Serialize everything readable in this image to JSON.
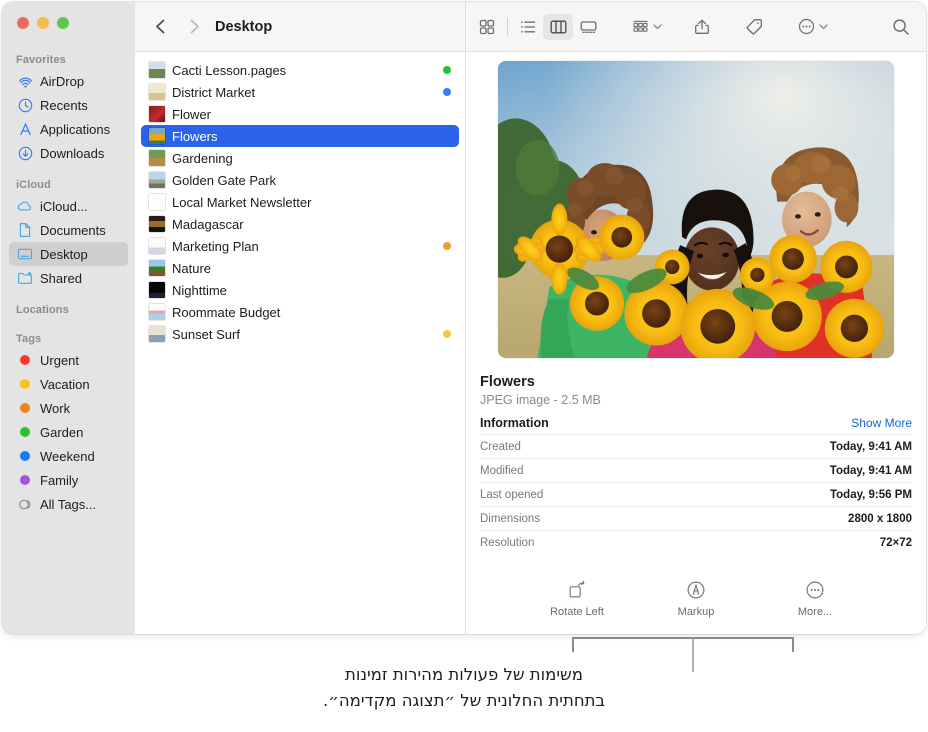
{
  "window": {
    "traffic_lights": [
      "close",
      "minimize",
      "zoom"
    ],
    "breadcrumb": "Desktop",
    "back_label": "Back",
    "forward_label": "Forward"
  },
  "sidebar": {
    "sections": [
      {
        "header": "Favorites",
        "items": [
          {
            "label": "AirDrop",
            "icon": "airdrop-icon",
            "selected": false
          },
          {
            "label": "Recents",
            "icon": "clock-icon",
            "selected": false
          },
          {
            "label": "Applications",
            "icon": "applications-icon",
            "selected": false
          },
          {
            "label": "Downloads",
            "icon": "downloads-icon",
            "selected": false
          }
        ]
      },
      {
        "header": "iCloud",
        "items": [
          {
            "label": "iCloud...",
            "icon": "cloud-icon",
            "selected": false
          },
          {
            "label": "Documents",
            "icon": "document-icon",
            "selected": false
          },
          {
            "label": "Desktop",
            "icon": "desktop-icon",
            "selected": true
          },
          {
            "label": "Shared",
            "icon": "shared-folder-icon",
            "selected": false
          }
        ]
      },
      {
        "header": "Locations",
        "items": []
      },
      {
        "header": "Tags",
        "items": [
          {
            "label": "Urgent",
            "icon": "tag-dot-icon",
            "color": "#fa3b2f",
            "selected": false
          },
          {
            "label": "Vacation",
            "icon": "tag-dot-icon",
            "color": "#fcc318",
            "selected": false
          },
          {
            "label": "Work",
            "icon": "tag-dot-icon",
            "color": "#f08413",
            "selected": false
          },
          {
            "label": "Garden",
            "icon": "tag-dot-icon",
            "color": "#29c330",
            "selected": false
          },
          {
            "label": "Weekend",
            "icon": "tag-dot-icon",
            "color": "#177cf5",
            "selected": false
          },
          {
            "label": "Family",
            "icon": "tag-dot-icon",
            "color": "#a554e0",
            "selected": false
          },
          {
            "label": "All Tags...",
            "icon": "all-tags-icon",
            "color": "",
            "selected": false
          }
        ]
      }
    ]
  },
  "toolbar": {
    "buttons": [
      {
        "name": "icon-view-button",
        "label": "Icon View",
        "active": false
      },
      {
        "name": "list-view-button",
        "label": "List View",
        "active": false
      },
      {
        "name": "column-view-button",
        "label": "Column View",
        "active": true
      },
      {
        "name": "gallery-view-button",
        "label": "Gallery View",
        "active": false
      },
      {
        "name": "group-by-button",
        "label": "Group",
        "active": false
      },
      {
        "name": "share-button",
        "label": "Share",
        "active": false
      },
      {
        "name": "tags-button",
        "label": "Tags",
        "active": false
      },
      {
        "name": "more-actions-button",
        "label": "More",
        "active": false
      },
      {
        "name": "search-button",
        "label": "Search",
        "active": false
      }
    ]
  },
  "file_list": {
    "items": [
      {
        "name": "Cacti Lesson.pages",
        "tag_color": "#29c330",
        "selected": false
      },
      {
        "name": "District Market",
        "tag_color": "#3b7df4",
        "selected": false
      },
      {
        "name": "Flower",
        "tag_color": "",
        "selected": false
      },
      {
        "name": "Flowers",
        "tag_color": "",
        "selected": true
      },
      {
        "name": "Gardening",
        "tag_color": "",
        "selected": false
      },
      {
        "name": "Golden Gate Park",
        "tag_color": "",
        "selected": false
      },
      {
        "name": "Local Market Newsletter",
        "tag_color": "",
        "selected": false
      },
      {
        "name": "Madagascar",
        "tag_color": "",
        "selected": false
      },
      {
        "name": "Marketing Plan",
        "tag_color": "#f0983a",
        "selected": false
      },
      {
        "name": "Nature",
        "tag_color": "",
        "selected": false
      },
      {
        "name": "Nighttime",
        "tag_color": "",
        "selected": false
      },
      {
        "name": "Roommate Budget",
        "tag_color": "",
        "selected": false
      },
      {
        "name": "Sunset Surf",
        "tag_color": "#f6c945",
        "selected": false
      }
    ]
  },
  "preview": {
    "image_alt": "Three smiling people holding large bunches of sunflowers in a field",
    "title": "Flowers",
    "subtitle": "JPEG image - 2.5 MB",
    "information_label": "Information",
    "show_more_label": "Show More",
    "rows": [
      {
        "key": "Created",
        "value": "Today, 9:41 AM"
      },
      {
        "key": "Modified",
        "value": "Today, 9:41 AM"
      },
      {
        "key": "Last opened",
        "value": "Today, 9:56 PM"
      },
      {
        "key": "Dimensions",
        "value": "2800 x 1800"
      },
      {
        "key": "Resolution",
        "value": "72×72"
      }
    ],
    "quick_actions": [
      {
        "label": "Rotate Left",
        "icon": "rotate-left-icon"
      },
      {
        "label": "Markup",
        "icon": "markup-icon"
      },
      {
        "label": "More...",
        "icon": "more-ellipsis-icon"
      }
    ]
  },
  "caption": {
    "line1": "משימות של פעולות מהירות זמינות",
    "line2": "בתחתית החלונית של ״תצוגה מקדימה״."
  },
  "colors": {
    "selection_blue": "#2a62e8",
    "link_blue": "#1168d8",
    "sidebar_bg": "#e4e4e4",
    "toolbar_bg": "#f6f6f6"
  }
}
